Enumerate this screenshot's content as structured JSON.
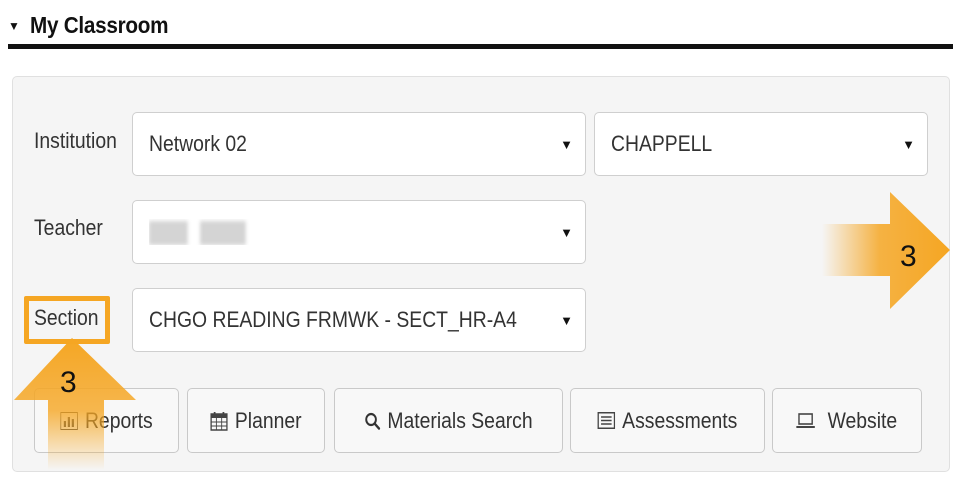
{
  "section_header": {
    "title": "My Classroom"
  },
  "form": {
    "institution_label": "Institution",
    "institution_value": "Network 02",
    "school_value": "CHAPPELL",
    "teacher_label": "Teacher",
    "section_label": "Section",
    "section_value": "CHGO READING FRMWK - SECT_HR-A4"
  },
  "buttons": {
    "reports": "Reports",
    "planner": "Planner",
    "materials_search": "Materials Search",
    "assessments": "Assessments",
    "website": "Website"
  },
  "callouts": {
    "right_number": "3",
    "left_number": "3"
  },
  "colors": {
    "callout": "#f5a623",
    "header_rule": "#111111",
    "panel_bg": "#f5f5f5"
  }
}
